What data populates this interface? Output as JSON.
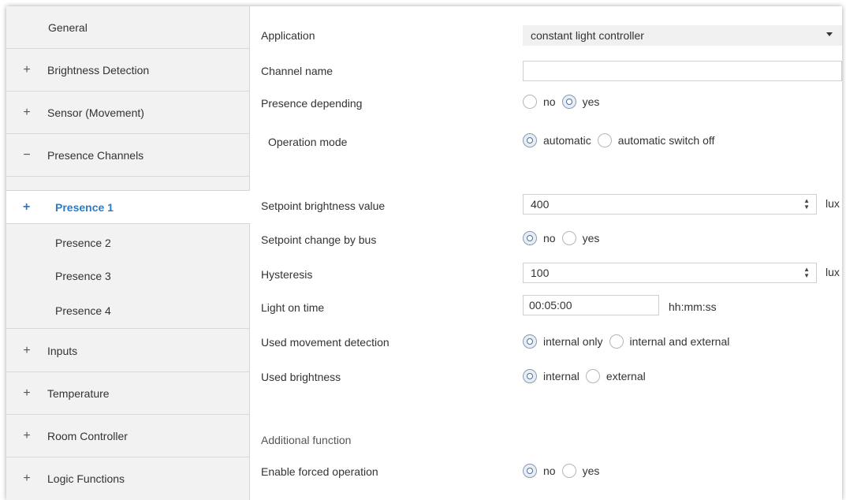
{
  "sidebar": {
    "items": [
      {
        "label": "General",
        "sign": ""
      },
      {
        "label": "Brightness Detection",
        "sign": "+"
      },
      {
        "label": "Sensor (Movement)",
        "sign": "+"
      },
      {
        "label": "Presence Channels",
        "sign": "−"
      }
    ],
    "subitems": [
      {
        "label": "Presence 1",
        "sign": "+",
        "active": true
      },
      {
        "label": "Presence 2"
      },
      {
        "label": "Presence 3"
      },
      {
        "label": "Presence 4"
      }
    ],
    "items_after": [
      {
        "label": "Inputs",
        "sign": "+"
      },
      {
        "label": "Temperature",
        "sign": "+"
      },
      {
        "label": "Room Controller",
        "sign": "+"
      },
      {
        "label": "Logic Functions",
        "sign": "+"
      }
    ]
  },
  "form": {
    "application": {
      "label": "Application",
      "value": "constant light controller"
    },
    "channel_name": {
      "label": "Channel name",
      "value": ""
    },
    "presence_depending": {
      "label": "Presence depending",
      "opt_no": "no",
      "opt_yes": "yes",
      "selected": "yes"
    },
    "operation_mode": {
      "label": "Operation mode",
      "opt_a": "automatic",
      "opt_b": "automatic switch off",
      "selected": "automatic"
    },
    "setpoint": {
      "label": "Setpoint brightness value",
      "value": "400",
      "unit": "lux"
    },
    "setpoint_bus": {
      "label": "Setpoint change by bus",
      "opt_no": "no",
      "opt_yes": "yes",
      "selected": "no"
    },
    "hysteresis": {
      "label": "Hysteresis",
      "value": "100",
      "unit": "lux"
    },
    "light_on_time": {
      "label": "Light on time",
      "value": "00:05:00",
      "unit": "hh:mm:ss"
    },
    "movement": {
      "label": "Used movement detection",
      "opt_a": "internal only",
      "opt_b": "internal and external",
      "selected": "internal only"
    },
    "brightness": {
      "label": "Used brightness",
      "opt_a": "internal",
      "opt_b": "external",
      "selected": "internal"
    },
    "additional": {
      "label": "Additional function"
    },
    "forced": {
      "label": "Enable forced operation",
      "opt_no": "no",
      "opt_yes": "yes",
      "selected": "no"
    }
  },
  "colors": {
    "accent": "#2b7cc7",
    "sidebar_bg": "#f2f2f2"
  }
}
